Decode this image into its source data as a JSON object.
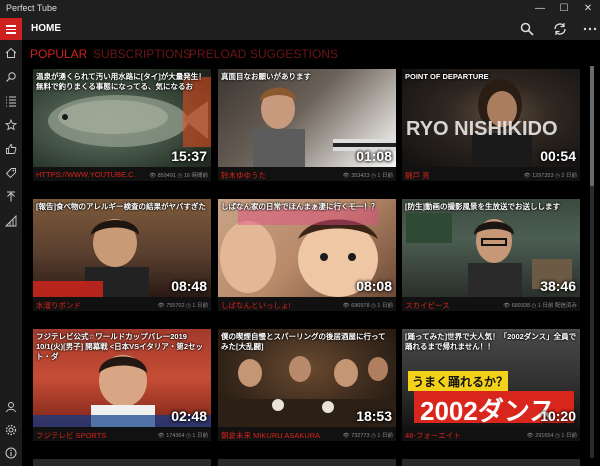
{
  "window": {
    "title": "Perfect Tube"
  },
  "header": {
    "title": "HOME"
  },
  "tabs": [
    {
      "label": "POPULAR",
      "active": true
    },
    {
      "label": "SUBSCRIPTIONS",
      "active": false
    },
    {
      "label": "PRELOAD",
      "active": false
    },
    {
      "label": "SUGGESTIONS",
      "active": false
    }
  ],
  "colors": {
    "accent": "#cf2020",
    "inactive_tab": "#6e1616",
    "background": "#000000"
  },
  "rail_icons": [
    "home-icon",
    "search-icon",
    "list-icon",
    "star-icon",
    "thumbs-up-icon",
    "tag-icon",
    "upload-icon",
    "signal-icon",
    "account-icon",
    "settings-icon",
    "info-icon"
  ],
  "videos": [
    {
      "title": "温泉が湧くられて汚い用水路に[タイ]が大量発生！無料で釣りまくる事態になってる、気になるお",
      "duration": "15:37",
      "channel": "HTTPS://WWW.YOUTUBE.C...",
      "views": "859491",
      "age": "16 時間前"
    },
    {
      "title": "真面目なお願いがあります",
      "duration": "01:08",
      "channel": "鈴木ゆゆうた",
      "views": "353423",
      "age": "1 日前"
    },
    {
      "title": "POINT OF DEPARTURE",
      "duration": "00:54",
      "channel": "錦戸 亮",
      "views": "1297353",
      "age": "2 日前"
    },
    {
      "title": "[報告]食べ物のアレルギー検査の結果がヤバすぎた",
      "duration": "08:48",
      "channel": "水溜りボンド",
      "views": "755702",
      "age": "1 日前"
    },
    {
      "title": "しばなん家の日常でほんまぁ凄に行くモ一！？",
      "duration": "08:08",
      "channel": "しばなんといっしょ!",
      "views": "696978",
      "age": "1 日前"
    },
    {
      "title": "[防生]動画の撮影風景を生放送でお送しします",
      "duration": "38:46",
      "channel": "スカイピース",
      "views": "689338",
      "age": "1 日前 配信済み"
    },
    {
      "title": "フジテレビ公式☆ワールドカップバレー2019 10/1(火)[男子] 開幕戦 <日本VSイタリア・第2セット・ダ",
      "duration": "02:48",
      "channel": "フジテレビ SPORTS",
      "views": "174364",
      "age": "1 日前"
    },
    {
      "title": "僕の喫煙自慢とスパーリングの後居酒屋に行ってみた[大乱闘]",
      "duration": "18:53",
      "channel": "朝倉未来 MIKURU ASAKURA",
      "views": "732773",
      "age": "1 日前"
    },
    {
      "title": "[踊ってみた]世界で大人気！「2002ダンス」全員で踊れるまで帰れません！！",
      "duration": "10:20",
      "channel": "48-フォーエイト",
      "views": "291654",
      "age": "1 日前"
    }
  ],
  "thumb_overlays": [
    "2002ダンス",
    "うまく踊れるか？"
  ]
}
